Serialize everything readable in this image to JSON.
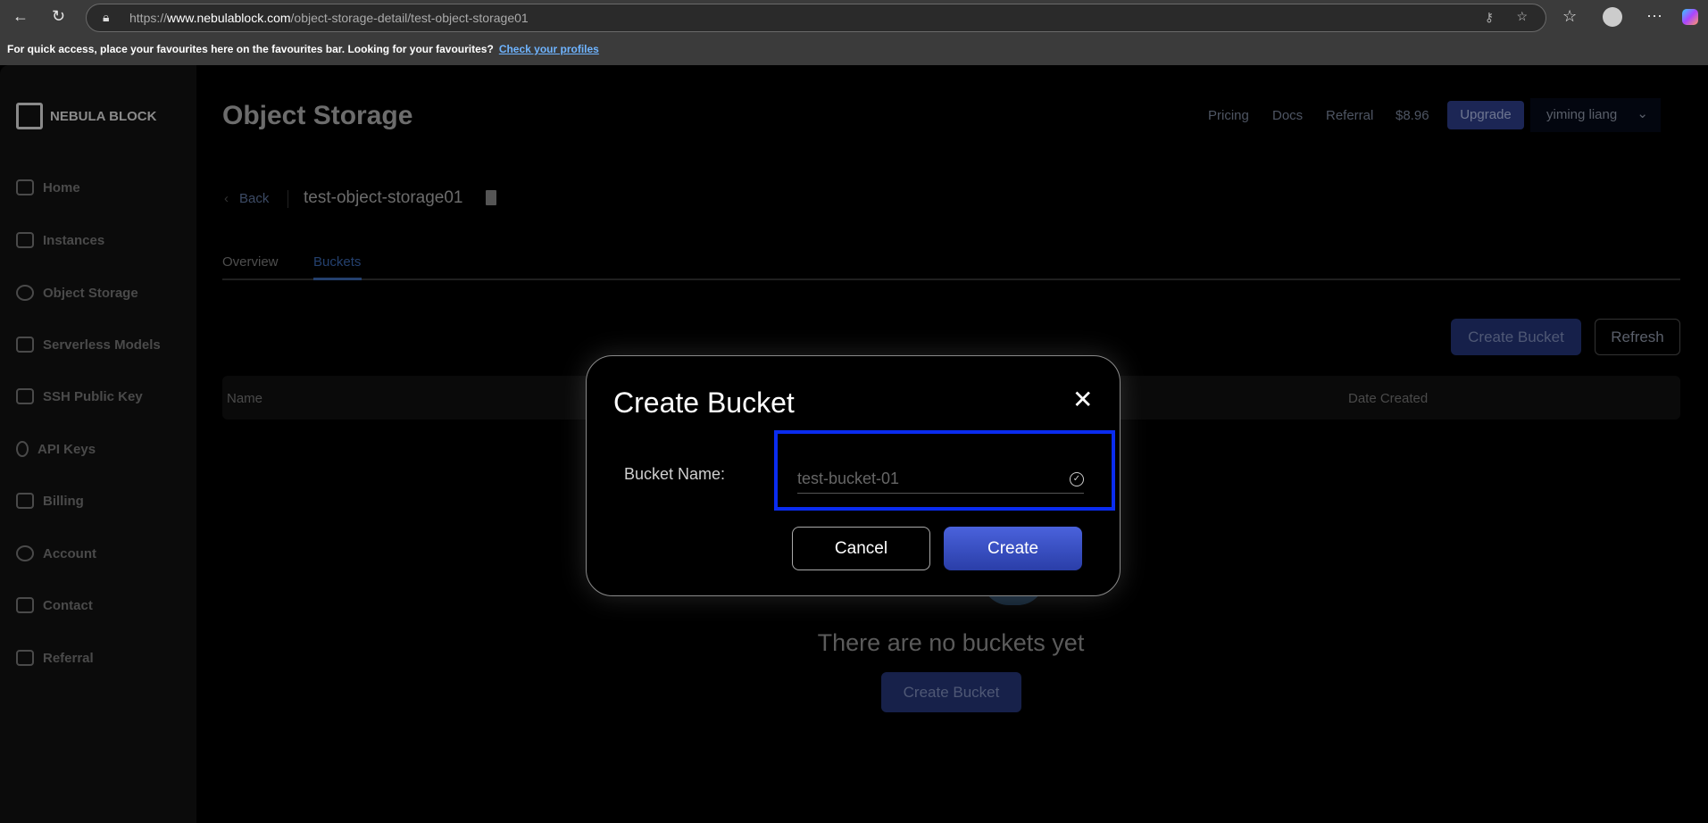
{
  "browser": {
    "url_prefix": "https://",
    "url_domain": "www.nebulablock.com",
    "url_path": "/object-storage-detail/test-object-storage01",
    "favbar_text": "For quick access, place your favourites here on the favourites bar. Looking for your favourites?",
    "favbar_link": "Check your profiles"
  },
  "sidebar": {
    "brand": "NEBULA BLOCK",
    "items": [
      {
        "label": "Home"
      },
      {
        "label": "Instances"
      },
      {
        "label": "Object Storage"
      },
      {
        "label": "Serverless Models"
      },
      {
        "label": "SSH Public Key"
      },
      {
        "label": "API Keys"
      },
      {
        "label": "Billing"
      },
      {
        "label": "Account"
      },
      {
        "label": "Contact"
      },
      {
        "label": "Referral"
      }
    ]
  },
  "header": {
    "title": "Object Storage",
    "pricing": "Pricing",
    "docs": "Docs",
    "referral": "Referral",
    "balance": "$8.96",
    "upgrade": "Upgrade",
    "user": "yiming liang"
  },
  "detail": {
    "back": "Back",
    "name": "test-object-storage01",
    "tabs": [
      {
        "label": "Overview"
      },
      {
        "label": "Buckets"
      }
    ],
    "create_bucket": "Create Bucket",
    "refresh": "Refresh",
    "columns": [
      "Name",
      "Date Created"
    ],
    "empty_text": "There are no buckets yet",
    "empty_create": "Create Bucket"
  },
  "dialog": {
    "title": "Create Bucket",
    "label": "Bucket Name:",
    "placeholder": "test-bucket-01",
    "cancel": "Cancel",
    "create": "Create"
  }
}
